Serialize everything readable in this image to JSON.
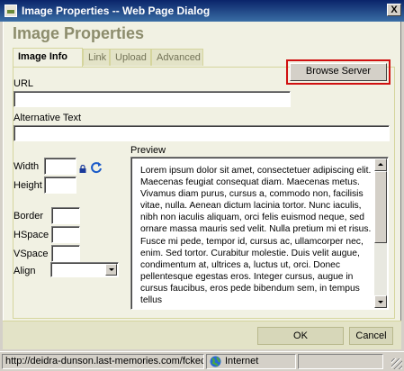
{
  "window": {
    "title": "Image Properties -- Web Page Dialog",
    "close_label": "X"
  },
  "dialog": {
    "title": "Image Properties"
  },
  "tabs": [
    {
      "label": "Image Info",
      "active": true
    },
    {
      "label": "Link",
      "active": false
    },
    {
      "label": "Upload",
      "active": false
    },
    {
      "label": "Advanced",
      "active": false
    }
  ],
  "fields": {
    "url_label": "URL",
    "url_value": "",
    "browse_label": "Browse Server",
    "alt_label": "Alternative Text",
    "alt_value": "",
    "width_label": "Width",
    "height_label": "Height",
    "border_label": "Border",
    "hspace_label": "HSpace",
    "vspace_label": "VSpace",
    "align_label": "Align",
    "align_value": ""
  },
  "preview": {
    "label": "Preview",
    "text": "Lorem ipsum dolor sit amet, consectetuer adipiscing elit. Maecenas feugiat consequat diam. Maecenas metus. Vivamus diam purus, cursus a, commodo non, facilisis vitae, nulla. Aenean dictum lacinia tortor. Nunc iaculis, nibh non iaculis aliquam, orci felis euismod neque, sed ornare massa mauris sed velit. Nulla pretium mi et risus. Fusce mi pede, tempor id, cursus ac, ullamcorper nec, enim. Sed tortor. Curabitur molestie. Duis velit augue, condimentum at, ultrices a, luctus ut, orci. Donec pellentesque egestas eros. Integer cursus, augue in cursus faucibus, eros pede bibendum sem, in tempus tellus"
  },
  "buttons": {
    "ok": "OK",
    "cancel": "Cancel"
  },
  "statusbar": {
    "url": "http://deidra-dunson.last-memories.com/fckec",
    "zone": "Internet"
  },
  "colors": {
    "highlight": "#d01010",
    "titlebar": "#0a246a",
    "dialog_bg": "#f1f1e3",
    "heading": "#8c8c6c"
  }
}
